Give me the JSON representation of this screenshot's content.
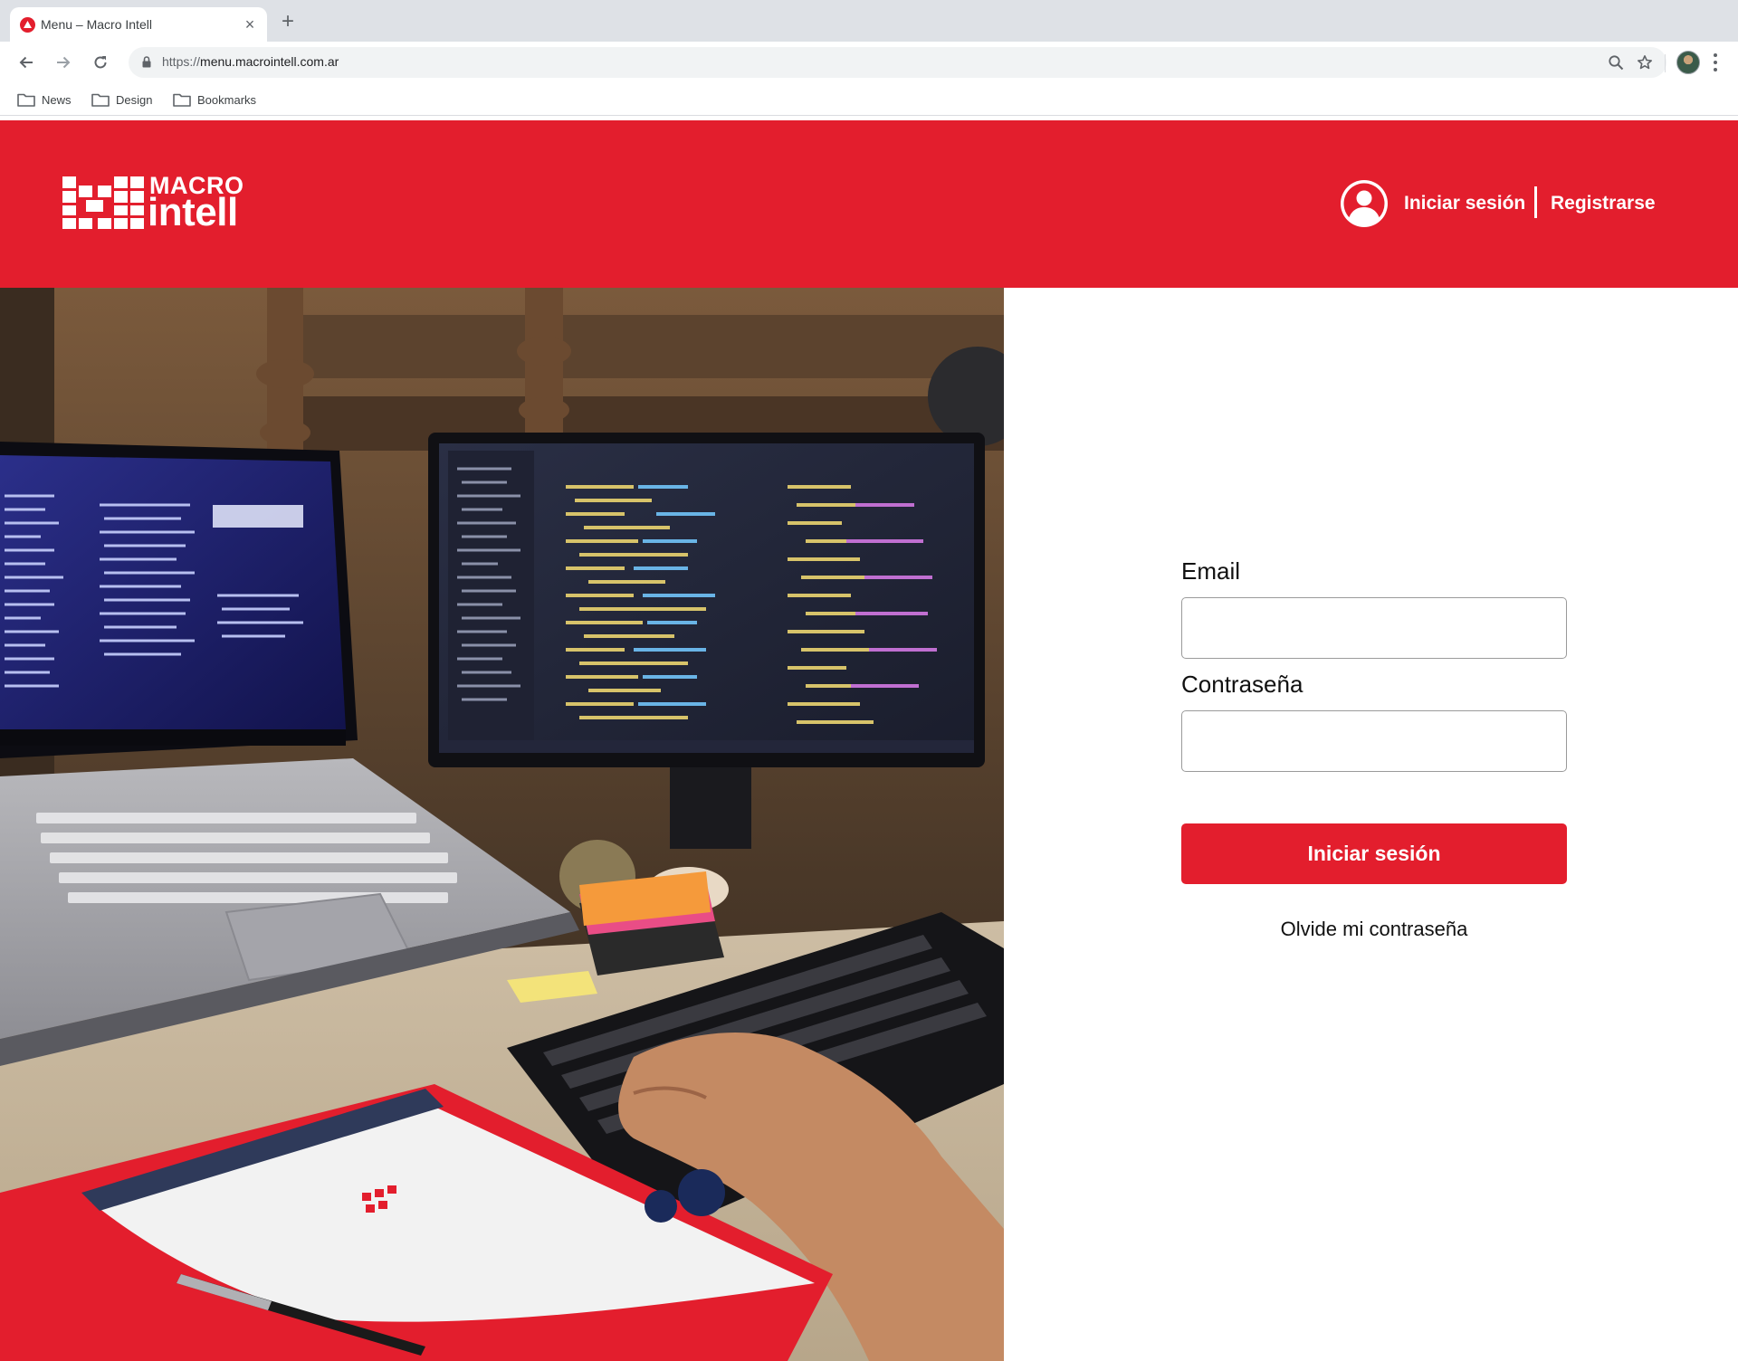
{
  "browser": {
    "tab_title": "Menu – Macro Intell",
    "url_scheme": "https://",
    "url_host": "menu.macrointell.com.ar",
    "bookmarks": [
      {
        "label": "News"
      },
      {
        "label": "Design"
      },
      {
        "label": "Bookmarks"
      }
    ]
  },
  "header": {
    "logo_top": "MACRO",
    "logo_bottom": "intell",
    "login_link": "Iniciar sesión",
    "register_link": "Registrarse"
  },
  "form": {
    "email_label": "Email",
    "email_value": "",
    "password_label": "Contraseña",
    "password_value": "",
    "submit_label": "Iniciar sesión",
    "forgot_label": "Olvide mi contraseña"
  },
  "colors": {
    "brand_red": "#e31e2d"
  }
}
